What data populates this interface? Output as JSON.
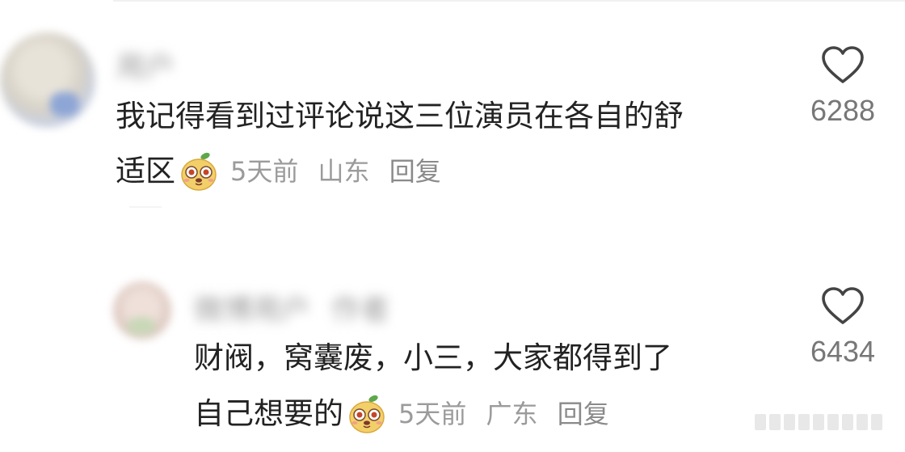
{
  "comments": [
    {
      "username": "用户",
      "line1": "我记得看到过评论说这三位演员在各自的舒",
      "line2": "适区",
      "time": "5天前",
      "location": "山东",
      "reply": "回复",
      "likes": "6288",
      "emoji": "dog-face-emoji"
    },
    {
      "username": "微博用户",
      "tag": "作者",
      "line1": "财阀，窝囊废，小三，大家都得到了",
      "line2": "自己想要的",
      "time": "5天前",
      "location": "广东",
      "reply": "回复",
      "likes": "6434",
      "emoji": "dog-face-emoji"
    }
  ],
  "colors": {
    "text": "#222222",
    "meta": "#9b9b9b",
    "heart_outline": "#444444",
    "emoji_face": "#f3cf6a",
    "emoji_leaf": "#5ea84a"
  }
}
